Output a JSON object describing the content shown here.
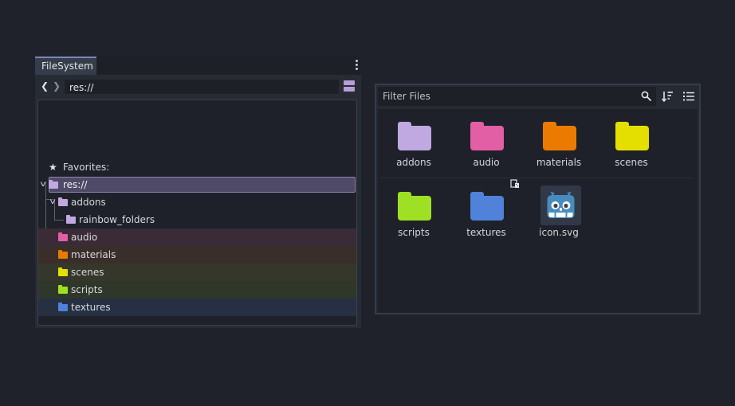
{
  "colors": {
    "addons": "#c0a8e0",
    "rainbow_folders": "#c0a8e0",
    "res": "#c0a8e0",
    "audio": "#e25ea5",
    "materials": "#ea7a00",
    "scenes": "#e5df00",
    "scripts": "#9ee024",
    "textures": "#4f82d8",
    "selection_bg": "#4f4a67",
    "selection_border": "#8c87ad"
  },
  "dock": {
    "tab_label": "FileSystem",
    "menu_icon": "vertical-dots-icon",
    "back_icon": "chevron-left-icon",
    "forward_icon": "chevron-right-icon",
    "path_value": "res://",
    "split_icon": "split-toggle-icon",
    "tree": {
      "favorites_label": "Favorites:",
      "root_label": "res://",
      "items": [
        {
          "label": "addons"
        },
        {
          "label": "rainbow_folders"
        },
        {
          "label": "audio"
        },
        {
          "label": "materials"
        },
        {
          "label": "scenes"
        },
        {
          "label": "scripts"
        },
        {
          "label": "textures"
        }
      ]
    }
  },
  "files": {
    "filter_placeholder": "Filter Files",
    "search_icon": "search-icon",
    "sort_icon": "sort-icon",
    "list_icon": "list-view-icon",
    "items": [
      {
        "label": "addons"
      },
      {
        "label": "audio"
      },
      {
        "label": "materials"
      },
      {
        "label": "scenes"
      },
      {
        "label": "scripts"
      },
      {
        "label": "textures"
      },
      {
        "label": "icon.svg"
      }
    ]
  }
}
